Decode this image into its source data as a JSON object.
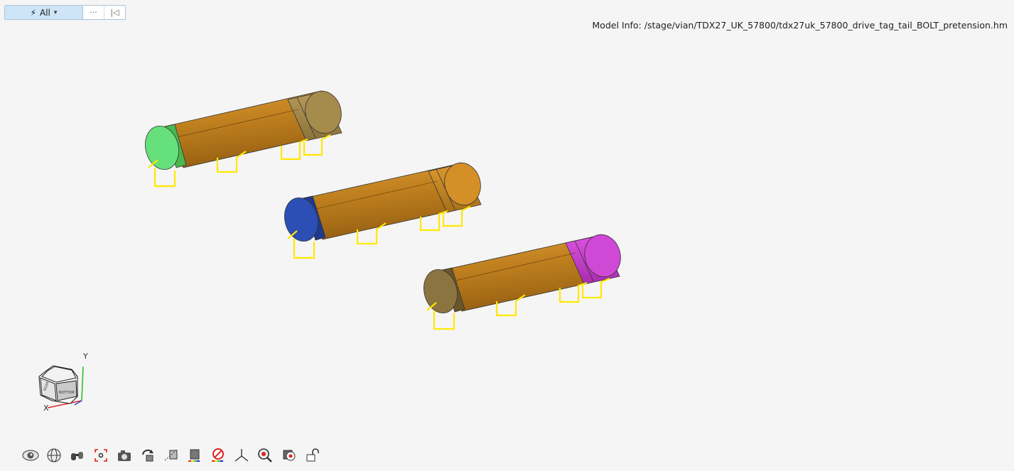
{
  "toolbar": {
    "selection_filter_label": "All",
    "selection_filter_icon": "lightning-icon",
    "more_label": "···",
    "collapse_label": "|◁"
  },
  "model_info": {
    "label": "Model Info:",
    "path": "/stage/vian/TDX27_UK_57800/tdx27uk_57800_drive_tag_tail_BOLT_pretension.hm"
  },
  "viewport": {
    "background": "#f5f5f5",
    "bolts": [
      {
        "head_color": "#5ed66a",
        "shank_color": "#b97a1c",
        "nut_color": "#a2884a"
      },
      {
        "head_color": "#2b4fb4",
        "shank_color": "#b97a1c",
        "nut_color": "#c88a1c"
      },
      {
        "head_color": "#8b7440",
        "shank_color": "#b97a1c",
        "nut_color": "#c93ccf"
      }
    ],
    "constraint_color": "#ffff00"
  },
  "axis_triad": {
    "y_label": "Y",
    "x_label": "X"
  },
  "bottom_toolbar": {
    "icons": [
      "eye-icon",
      "globe-icon",
      "binoculars-icon",
      "fit-view-icon",
      "camera-icon",
      "rotate-view-icon",
      "clipping-icon",
      "contour-icon",
      "legend-icon",
      "measure-icon",
      "triad-icon",
      "zoom-icon",
      "isolate-icon",
      "unlock-icon"
    ]
  }
}
